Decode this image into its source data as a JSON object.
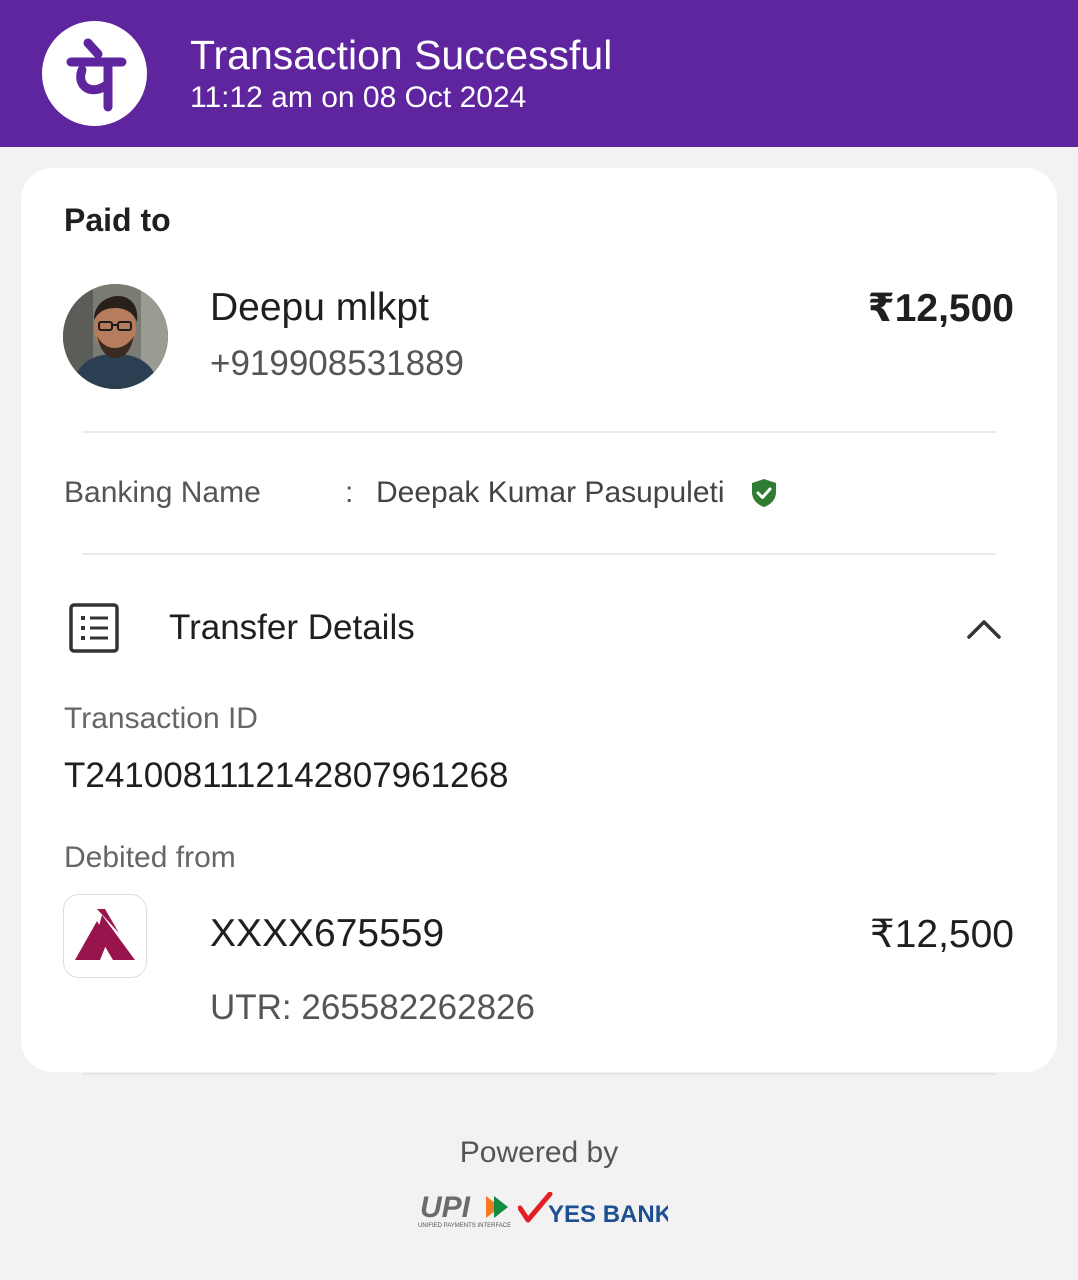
{
  "header": {
    "title": "Transaction Successful",
    "datetime": "11:12 am on 08 Oct 2024",
    "brand_color": "#5f259f"
  },
  "payment": {
    "paid_to_label": "Paid to",
    "payee_name": "Deepu mlkpt",
    "payee_phone": "+919908531889",
    "amount": "₹12,500"
  },
  "banking": {
    "label": "Banking Name",
    "separator": ":",
    "value": "Deepak Kumar Pasupuleti",
    "verified_color": "#2e7d32"
  },
  "transfer": {
    "title": "Transfer Details",
    "transaction_id_label": "Transaction ID",
    "transaction_id": "T2410081112142807961268",
    "debited_from_label": "Debited from",
    "account": "XXXX675559",
    "debited_amount": "₹12,500",
    "utr": "UTR: 265582262826",
    "bank_color": "#97144d"
  },
  "footer": {
    "powered_by": "Powered by",
    "upi_text": "UPI",
    "upi_tagline": "UNIFIED PAYMENTS INTERFACE",
    "bank_name": "YES BANK"
  },
  "icons": {
    "app_logo": "phonepe-logo-icon",
    "verified": "verified-shield-icon",
    "transfer": "list-document-icon",
    "collapse": "chevron-up-icon",
    "bank": "axis-bank-logo-icon"
  }
}
